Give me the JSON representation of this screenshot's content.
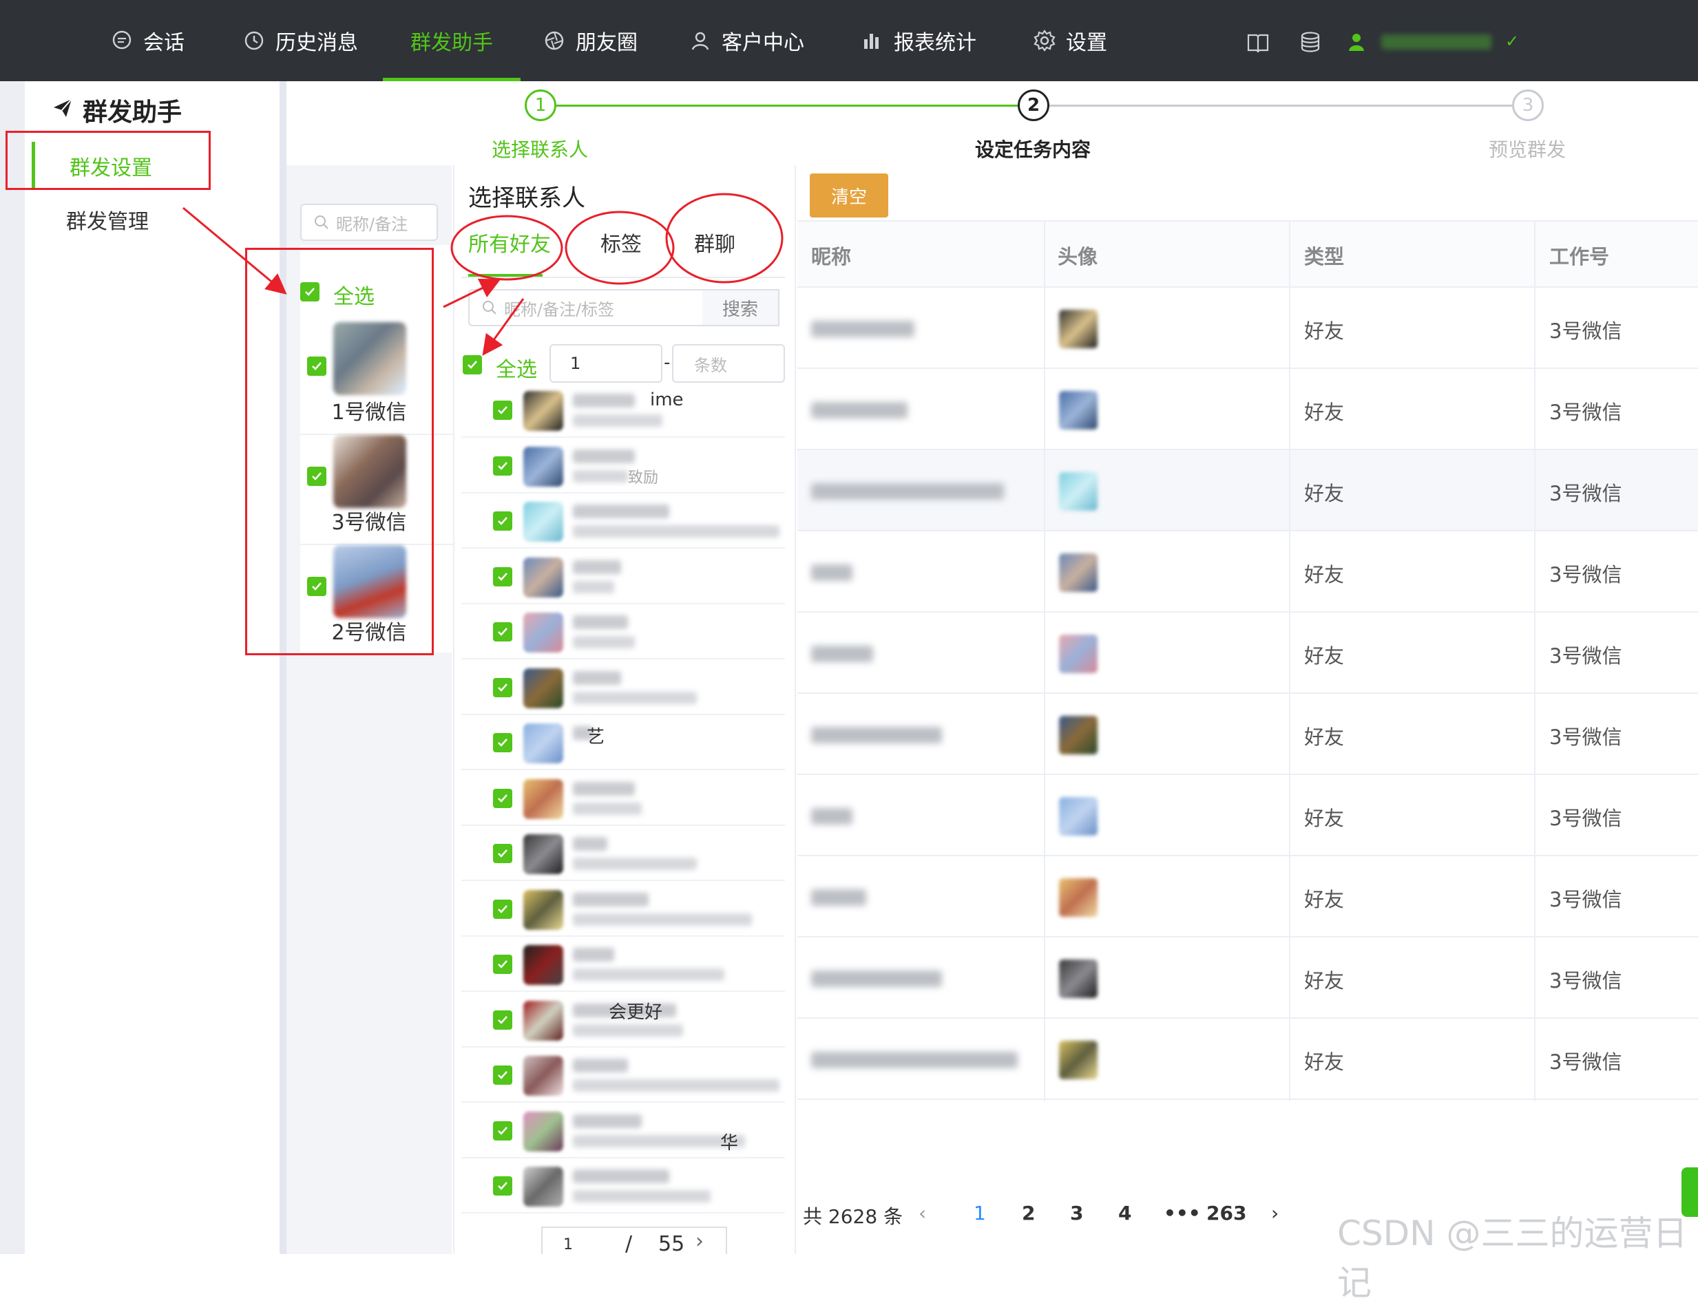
{
  "nav": {
    "items": [
      {
        "label": "会话",
        "icon": "chat-icon"
      },
      {
        "label": "历史消息",
        "icon": "clock-icon"
      },
      {
        "label": "群发助手",
        "icon": "",
        "active": true
      },
      {
        "label": "朋友圈",
        "icon": "aperture-icon"
      },
      {
        "label": "客户中心",
        "icon": "user-icon"
      },
      {
        "label": "报表统计",
        "icon": "bar-chart-icon"
      },
      {
        "label": "设置",
        "icon": "gear-icon"
      }
    ],
    "tools": [
      "book-icon",
      "database-icon"
    ],
    "accent": "#52c41a",
    "background": "#2f3237"
  },
  "sidebar": {
    "title": "群发助手",
    "items": [
      {
        "label": "群发设置",
        "active": true
      },
      {
        "label": "群发管理"
      }
    ]
  },
  "steps": [
    {
      "num": "1",
      "label": "选择联系人",
      "state": "done"
    },
    {
      "num": "2",
      "label": "设定任务内容",
      "state": "current"
    },
    {
      "num": "3",
      "label": "预览群发",
      "state": "pending"
    }
  ],
  "accounts": {
    "search_placeholder": "昵称/备注",
    "select_all": "全选",
    "list": [
      {
        "name": "1号微信",
        "checked": true
      },
      {
        "name": "3号微信",
        "checked": true
      },
      {
        "name": "2号微信",
        "checked": true
      }
    ]
  },
  "contacts": {
    "title": "选择联系人",
    "tabs": [
      "所有好友",
      "标签",
      "群聊"
    ],
    "search_placeholder": "昵称/备注/标签",
    "search_button": "搜索",
    "select_all": "全选",
    "range_from": "1",
    "range_dash": "-",
    "range_to_placeholder": "条数",
    "visible_fragments": [
      "ime",
      "致励",
      "艺",
      "会更好",
      "华"
    ],
    "pager": {
      "current": "1",
      "sep": "/",
      "total": "55"
    }
  },
  "table": {
    "clear_button": "清空",
    "columns": [
      "昵称",
      "头像",
      "类型",
      "工作号"
    ],
    "rows": [
      {
        "type": "好友",
        "account": "3号微信"
      },
      {
        "type": "好友",
        "account": "3号微信"
      },
      {
        "type": "好友",
        "account": "3号微信"
      },
      {
        "type": "好友",
        "account": "3号微信"
      },
      {
        "type": "好友",
        "account": "3号微信"
      },
      {
        "type": "好友",
        "account": "3号微信"
      },
      {
        "type": "好友",
        "account": "3号微信"
      },
      {
        "type": "好友",
        "account": "3号微信"
      },
      {
        "type": "好友",
        "account": "3号微信"
      },
      {
        "type": "好友",
        "account": "3号微信"
      }
    ]
  },
  "pagination": {
    "total": "共 2628 条",
    "pages": [
      "1",
      "2",
      "3",
      "4",
      "•••",
      "263"
    ],
    "current": "1"
  },
  "watermark": "CSDN @三三的运营日记"
}
